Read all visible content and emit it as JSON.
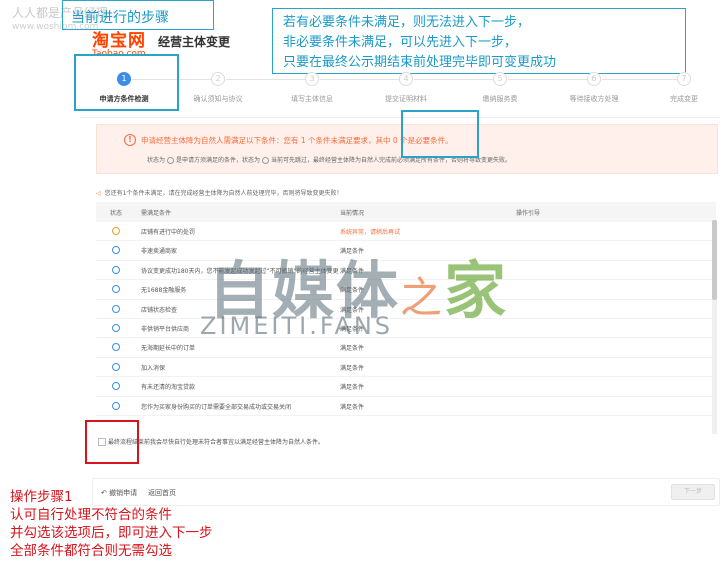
{
  "annotations": {
    "step_title": "当前进行的步骤",
    "note_lines": [
      "若有必要条件未满足，则无法进入下一步，",
      "非必要条件未满足，可以先进入下一步，",
      "只要在最终公示期结束前处理完毕即可变更成功"
    ],
    "bottom_lines": [
      "操作步骤1",
      "认可自行处理不符合的条件",
      "并勾选该选项后，即可进入下一步",
      "全部条件都符合则无需勾选"
    ],
    "watermark_top": "人人都是产品经理",
    "watermark_url": "www.woshipm.com"
  },
  "watermark": {
    "cn_a": "自媒体",
    "cn_zhi": "之",
    "cn_jia": "家",
    "en": "ZIMEITI.FANS"
  },
  "header": {
    "logo_cn": "淘宝网",
    "logo_en": "Taobao.com",
    "title": "经营主体变更"
  },
  "steps": [
    {
      "num": "1",
      "label": "申请方条件检测"
    },
    {
      "num": "2",
      "label": "确认须知与协议"
    },
    {
      "num": "3",
      "label": "填写主体信息"
    },
    {
      "num": "4",
      "label": "提交证明材料"
    },
    {
      "num": "5",
      "label": "缴纳服务费"
    },
    {
      "num": "6",
      "label": "等待接收方处理"
    },
    {
      "num": "7",
      "label": "完成变更"
    }
  ],
  "alert": {
    "icon": "!",
    "main": "申请经营主体降为自然人需满足以下条件：您有 1 个条件未满足要求，其中 0 个是必要条件。",
    "sub_a": "状态为",
    "sub_b": "是申请方须满足的条件，状态为",
    "sub_c": "当前可先跳过，最终经营主体降为自然人完成前必须满足所有条件，否则将导致变更失败。"
  },
  "notice": "您还有1个条件未满足，请在完成经营主体降为自然人前处理完毕，否则将导致变更失败！",
  "table": {
    "headers": {
      "status": "状态",
      "condition": "需满足条件",
      "current": "当前情况",
      "action": "操作引导"
    },
    "rows": [
      {
        "cond": "店铺有进行中的处罚",
        "st": "系统异常，请稍后再试",
        "bad": true
      },
      {
        "cond": "非速卖通商家",
        "st": "满足条件",
        "bad": false
      },
      {
        "cond": "协议变更成功180天内，您不能发起成功发起过“不可撤销”的经营主体变更",
        "st": "满足条件",
        "bad": false
      },
      {
        "cond": "无1688金融服务",
        "st": "满足条件",
        "bad": false
      },
      {
        "cond": "店铺状态检查",
        "st": "满足条件",
        "bad": false
      },
      {
        "cond": "非供销平台供应商",
        "st": "满足条件",
        "bad": false
      },
      {
        "cond": "无海期延长中的订单",
        "st": "满足条件",
        "bad": false
      },
      {
        "cond": "加入消保",
        "st": "满足条件",
        "bad": false
      },
      {
        "cond": "有未还清的淘宝贷款",
        "st": "满足条件",
        "bad": false
      },
      {
        "cond": "您作为买家身份购买的订单需要全部交易成功或交易关闭",
        "st": "满足条件",
        "bad": false
      }
    ]
  },
  "final_check": "最终流程结束前我会尽快自行处理未符合者事宜以满足经营主体降为自然人条件。",
  "footer": {
    "undo": "撤销申请",
    "back": "返回首页",
    "next": "下一步"
  },
  "colors": {
    "accent": "#3d8ee6",
    "warning": "#f56c3b",
    "annotation_blue": "#2aa3c9",
    "annotation_red": "#d6141c"
  }
}
